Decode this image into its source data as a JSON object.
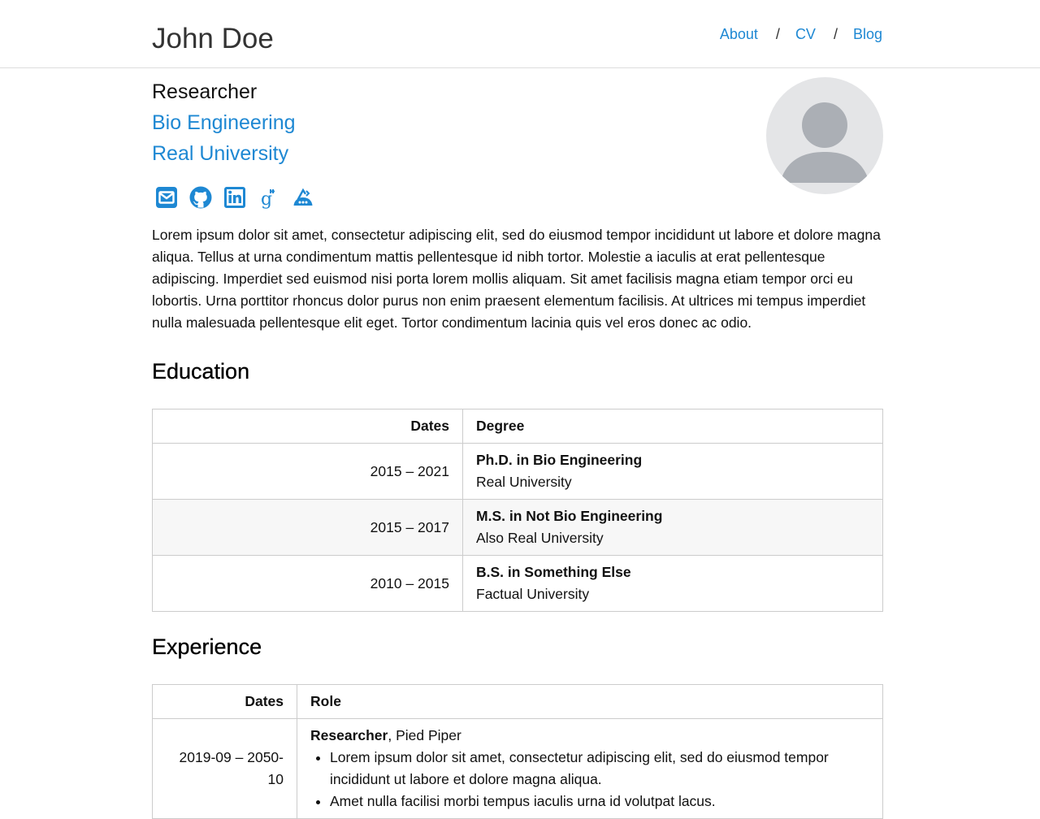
{
  "header": {
    "site_title": "John Doe",
    "nav": [
      {
        "label": "About"
      },
      {
        "label": "CV"
      },
      {
        "label": "Blog"
      }
    ],
    "separator": "/"
  },
  "profile": {
    "position": "Researcher",
    "department": "Bio Engineering",
    "university": "Real University",
    "social_icons": [
      "email-icon",
      "github-icon",
      "linkedin-icon",
      "google-scholar-icon",
      "semantic-scholar-icon"
    ],
    "bio": "Lorem ipsum dolor sit amet, consectetur adipiscing elit, sed do eiusmod tempor incididunt ut labore et dolore magna aliqua. Tellus at urna condimentum mattis pellentesque id nibh tortor. Molestie a iaculis at erat pellentesque adipiscing. Imperdiet sed euismod nisi porta lorem mollis aliquam. Sit amet facilisis magna etiam tempor orci eu lobortis. Urna porttitor rhoncus dolor purus non enim praesent elementum facilisis. At ultrices mi tempus imperdiet nulla malesuada pellentesque elit eget. Tortor condimentum lacinia quis vel eros donec ac odio."
  },
  "education": {
    "heading": "Education",
    "col_dates": "Dates",
    "col_degree": "Degree",
    "rows": [
      {
        "dates": "2015 – 2021",
        "degree": "Ph.D. in Bio Engineering",
        "school": "Real University"
      },
      {
        "dates": "2015 – 2017",
        "degree": "M.S. in Not Bio Engineering",
        "school": "Also Real University"
      },
      {
        "dates": "2010 – 2015",
        "degree": "B.S. in Something Else",
        "school": "Factual University"
      }
    ]
  },
  "experience": {
    "heading": "Experience",
    "col_dates": "Dates",
    "col_role": "Role",
    "rows": [
      {
        "dates": "2019-09 – 2050-10",
        "title": "Researcher",
        "org": ", Pied Piper",
        "bullets": [
          "Lorem ipsum dolor sit amet, consectetur adipiscing elit, sed do eiusmod tempor incididunt ut labore et dolore magna aliqua.",
          "Amet nulla facilisi morbi tempus iaculis urna id volutpat lacus."
        ]
      }
    ]
  },
  "colors": {
    "link": "#1e88d3",
    "text": "#111111",
    "border": "#cccccc",
    "row_alt": "#f7f7f7"
  }
}
